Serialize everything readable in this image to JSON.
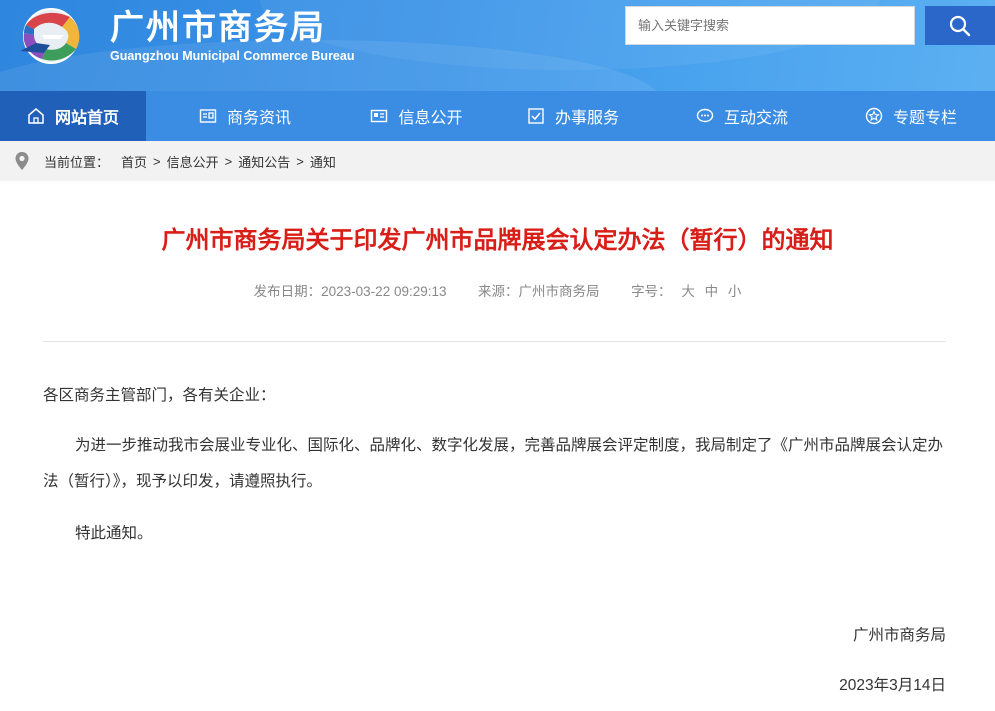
{
  "header": {
    "title": "广州市商务局",
    "subtitle": "Guangzhou Municipal Commerce Bureau",
    "logo_icon": "guangzhou-emblem-icon",
    "colors": {
      "header_bg": "#3d95e8",
      "nav_bg": "#3b8de3",
      "nav_active": "#2160b8",
      "search_btn": "#2a67c8"
    }
  },
  "search": {
    "placeholder": "输入关键字搜索",
    "value": "",
    "button_icon": "search-icon"
  },
  "nav": {
    "items": [
      {
        "label": "网站首页",
        "icon": "home-icon",
        "active": true
      },
      {
        "label": "商务资讯",
        "icon": "news-icon",
        "active": false
      },
      {
        "label": "信息公开",
        "icon": "info-card-icon",
        "active": false
      },
      {
        "label": "办事服务",
        "icon": "checkbox-icon",
        "active": false
      },
      {
        "label": "互动交流",
        "icon": "chat-bubble-icon",
        "active": false
      },
      {
        "label": "专题专栏",
        "icon": "star-icon",
        "active": false
      }
    ]
  },
  "breadcrumb": {
    "icon": "location-pin-icon",
    "label": "当前位置：",
    "items": [
      "首页",
      "信息公开",
      "通知公告",
      "通知"
    ],
    "separator": ">"
  },
  "article": {
    "title": "广州市商务局关于印发广州市品牌展会认定办法（暂行）的通知",
    "title_color": "#d91e18",
    "publish_label": "发布日期：",
    "publish_date": "2023-03-22 09:29:13",
    "source_label": "来源：",
    "source": "广州市商务局",
    "font_size_label": "字号：",
    "font_sizes": [
      "大",
      "中",
      "小"
    ],
    "salutation": "各区商务主管部门，各有关企业：",
    "paragraph": "为进一步推动我市会展业专业化、国际化、品牌化、数字化发展，完善品牌展会评定制度，我局制定了《广州市品牌展会认定办法（暂行）》，现予以印发，请遵照执行。",
    "closing": "特此通知。",
    "signature_org": "广州市商务局",
    "signature_date": "2023年3月14日"
  }
}
